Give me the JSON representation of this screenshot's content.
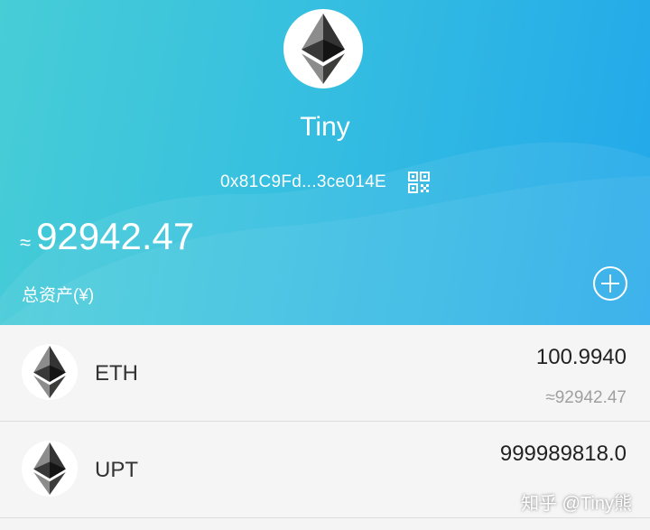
{
  "header": {
    "wallet_name": "Tiny",
    "address": "0x81C9Fd...3ce014E",
    "approx_symbol": "≈",
    "total_value": "92942.47",
    "total_label": "总资产(¥)",
    "avatar_icon": "ethereum-logo-icon",
    "qr_icon": "qr-code-icon",
    "add_icon": "plus-circle-icon"
  },
  "tokens": [
    {
      "symbol": "ETH",
      "balance": "100.9940",
      "fiat": "≈92942.47",
      "icon": "ethereum-logo-icon"
    },
    {
      "symbol": "UPT",
      "balance": "999989818.0",
      "icon": "ethereum-logo-icon"
    }
  ],
  "watermark": "知乎 @Tiny熊",
  "colors": {
    "header_gradient_start": "#47cdd6",
    "header_gradient_end": "#22a8ea",
    "list_background": "#f5f5f5",
    "secondary_text": "#a0a0a0"
  }
}
